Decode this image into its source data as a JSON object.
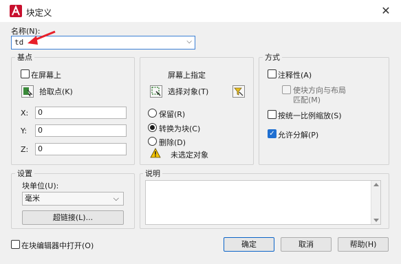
{
  "window": {
    "title": "块定义",
    "close_label": "✕"
  },
  "name": {
    "label": "名称(N):",
    "value": "td"
  },
  "base_point": {
    "title": "基点",
    "specify_on_screen": "在屏幕上",
    "pick_point": "拾取点(K)",
    "x_label": "X:",
    "x_value": "0",
    "y_label": "Y:",
    "y_value": "0",
    "z_label": "Z:",
    "z_value": "0"
  },
  "objects": {
    "title": "屏幕上指定",
    "select_objects": "选择对象(T)",
    "retain": "保留(R)",
    "convert": "转换为块(C)",
    "delete": "删除(D)",
    "status": "未选定对象"
  },
  "behavior": {
    "title": "方式",
    "annotative": "注释性(A)",
    "match_orientation": "使块方向与布局匹配(M)",
    "match_orientation_line1": "使块方向与布局",
    "match_orientation_line2": "匹配(M)",
    "scale_uniformly": "按统一比例缩放(S)",
    "allow_exploding": "允许分解(P)"
  },
  "settings": {
    "title": "设置",
    "block_unit_label": "块单位(U):",
    "block_unit_value": "毫米",
    "hyperlink_button": "超链接(L)..."
  },
  "description": {
    "title": "说明",
    "value": ""
  },
  "footer": {
    "open_in_editor": "在块编辑器中打开(O)",
    "ok": "确定",
    "cancel": "取消",
    "help": "帮助(H)"
  },
  "colors": {
    "accent": "#1f6fd1",
    "app_icon": "#c8102e",
    "annotation_arrow": "#e8202a"
  }
}
